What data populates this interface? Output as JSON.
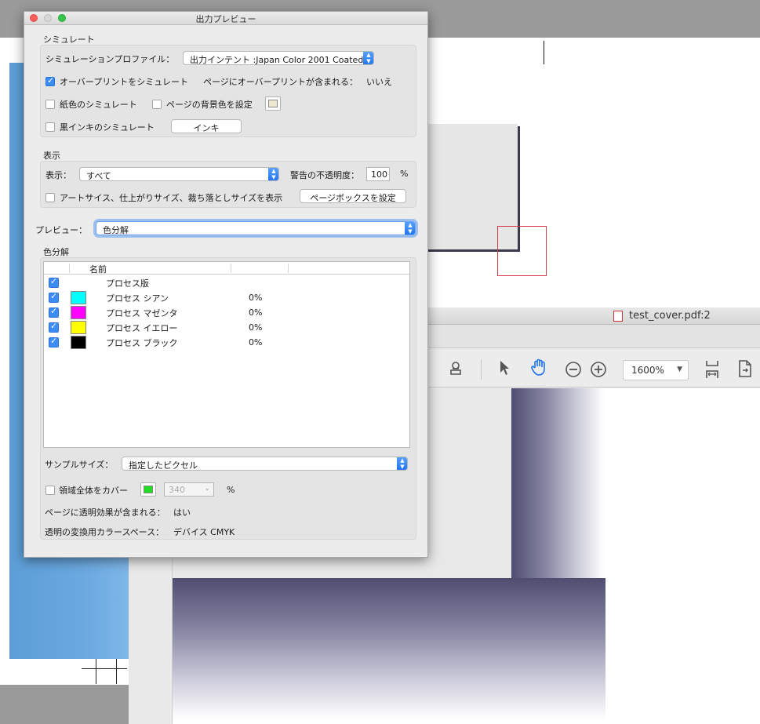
{
  "dialog": {
    "title": "出力プレビュー",
    "simulate": {
      "heading": "シミュレート",
      "profile_label": "シミュレーションプロファイル：",
      "profile_value": "出力インテント :Japan Color 2001 Coated",
      "overprint_label": "オーバープリントをシミュレート",
      "overprint_checked": true,
      "page_has_overprint_label": "ページにオーバープリントが含まれる：",
      "page_has_overprint_value": "いいえ",
      "paper_color_label": "紙色のシミュレート",
      "page_bg_label": "ページの背景色を設定",
      "black_ink_label": "黒インキのシミュレート",
      "ink_button": "インキ"
    },
    "display": {
      "heading": "表示",
      "show_label": "表示：",
      "show_value": "すべて",
      "warning_opacity_label": "警告の不透明度：",
      "warning_opacity_value": "100",
      "percent": "%",
      "art_trim_label": "アートサイス、仕上がりサイズ、裁ち落としサイズを表示",
      "page_box_button": "ページボックスを設定"
    },
    "preview": {
      "label": "プレビュー：",
      "value": "色分解"
    },
    "separations": {
      "heading": "色分解",
      "column_name": "名前",
      "rows": [
        {
          "name": "プロセス版",
          "swatch": null,
          "pct": ""
        },
        {
          "name": "プロセス シアン",
          "swatch": "#00ffff",
          "pct": "0%"
        },
        {
          "name": "プロセス マゼンタ",
          "swatch": "#ff00ff",
          "pct": "0%"
        },
        {
          "name": "プロセス イエロー",
          "swatch": "#ffff00",
          "pct": "0%"
        },
        {
          "name": "プロセス ブラック",
          "swatch": "#000000",
          "pct": "0%"
        }
      ]
    },
    "sample": {
      "label": "サンプルサイズ：",
      "value": "指定したピクセル"
    },
    "coverage": {
      "label": "領域全体をカバー",
      "value": "340",
      "percent": "%",
      "swatch_color": "#22dd22"
    },
    "transparency": {
      "label": "ページに透明効果が含まれる：",
      "value": "はい"
    },
    "blend_space": {
      "label": "透明の変換用カラースペース：",
      "value": "デバイス CMYK"
    }
  },
  "document": {
    "title": "test_cover.pdf:2",
    "zoom": "1600%"
  },
  "colors": {
    "accent_blue": "#3b8cf5",
    "shadow_purple": "#4f4e70",
    "strip_blue": "#6aa8e0",
    "crop_red": "#d23a4a"
  },
  "icons": [
    "stamp-icon",
    "arrow-pointer-icon",
    "hand-icon",
    "zoom-out-icon",
    "zoom-in-icon",
    "fit-page-icon",
    "export-icon",
    "pdf-file-icon"
  ]
}
